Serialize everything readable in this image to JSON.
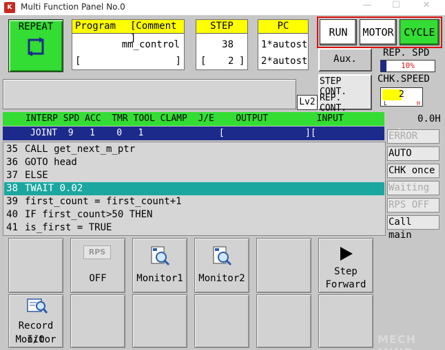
{
  "window": {
    "title": "Multi Function Panel No.0",
    "app_icon": "K",
    "controls": {
      "minimize": "—",
      "maximize": "☐",
      "close": "✕"
    }
  },
  "top": {
    "repeat_label": "REPEAT",
    "program": {
      "header": "Program",
      "comment_header": "[Comment ]",
      "name": "mm_control",
      "bracket_left": "[",
      "bracket_right": "]"
    },
    "step": {
      "header": "STEP",
      "value": "38",
      "bracket_left": "[",
      "sub_value": "2",
      "bracket_right": "]"
    },
    "pc": {
      "header": "PC",
      "line1": "1*autost",
      "line2": "2*autost"
    },
    "run_label": "RUN",
    "motor_label": "MOTOR",
    "cycle_label": "CYCLE",
    "aux_label": "Aux.",
    "rep_spd_label": "REP. SPD",
    "rep_spd_value": "10%",
    "rep_spd_fraction": 0.1,
    "step_cont_label": "STEP CONT.",
    "rep_cont_label": "REP. CONT.",
    "chk_speed_label": "CHK.SPEED",
    "chk_speed_value": "2",
    "chk_speed_low": "L",
    "chk_speed_high": "H",
    "lv_label": "Lv2"
  },
  "status_header": {
    "columns": "INTERP SPD ACC  TMR TOOL CLAMP  J/E    OUTPUT         INPUT",
    "row": "JOINT  9   1    0   1              [               ][               ]",
    "right_value": "0.0H"
  },
  "program_lines": [
    {
      "num": "35",
      "text": "CALL get_next_m_ptr"
    },
    {
      "num": "36",
      "text": "GOTO head"
    },
    {
      "num": "37",
      "text": "ELSE"
    },
    {
      "num": "38",
      "text": "TWAIT 0.02",
      "selected": true
    },
    {
      "num": "39",
      "text": "first_count = first_count+1"
    },
    {
      "num": "40",
      "text": "IF first_count>50 THEN"
    },
    {
      "num": "41",
      "text": "is_first = TRUE"
    }
  ],
  "side_buttons": [
    {
      "label": "ERROR",
      "dim": true
    },
    {
      "label": "AUTO",
      "dim": false
    },
    {
      "label": "CHK once",
      "dim": false
    },
    {
      "label": "Waiting",
      "dim": true
    },
    {
      "label": "RPS OFF",
      "dim": true
    },
    {
      "label": "Call main",
      "dim": false
    }
  ],
  "bottom": {
    "rps_icon_label": "RPS",
    "rps_value": "OFF",
    "monitor1_label": "Monitor1",
    "monitor2_label": "Monitor2",
    "step_forward_line1": "Step",
    "step_forward_line2": "Forward",
    "record_io_line1": "Record I/O",
    "record_io_line2": "Monitor"
  },
  "watermark": "MECH MIND",
  "colors": {
    "green": "#33dd33",
    "yellow": "#ffff00",
    "navy": "#1c2a8c",
    "teal": "#1aa7a0",
    "red_outline": "#e01010",
    "panel_gray": "#c7c7c7"
  }
}
